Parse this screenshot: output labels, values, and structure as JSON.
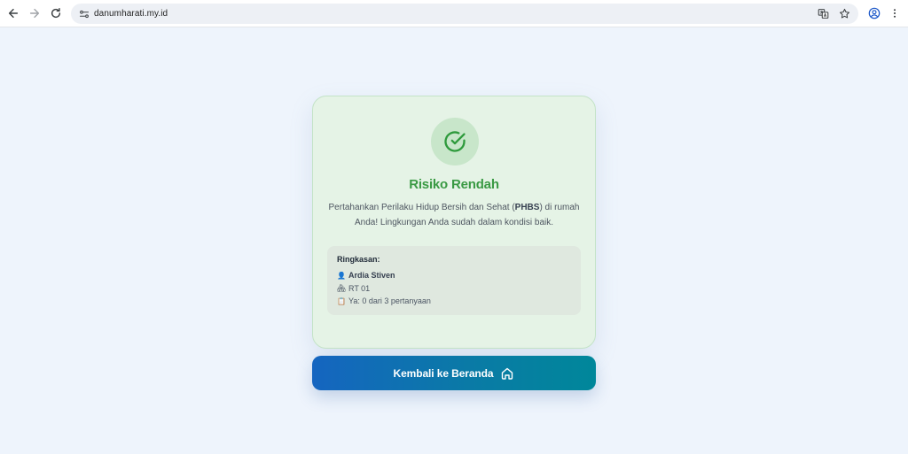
{
  "browser": {
    "url": "danumharati.my.id"
  },
  "result": {
    "status_icon": "check-circle-icon",
    "title": "Risiko Rendah",
    "message_before": "Pertahankan Perilaku Hidup Bersih dan Sehat (",
    "message_bold": "PHBS",
    "message_after": ") di rumah Anda! Lingkungan Anda sudah dalam kondisi baik.",
    "accent_color": "#3a9a44",
    "background_color": "#e5f3e6"
  },
  "summary": {
    "title": "Ringkasan:",
    "name_icon": "👤",
    "name": "Ardia Stiven",
    "rt_icon": "🏘",
    "rt": "RT 01",
    "answers_icon": "📋",
    "answers": "Ya: 0 dari 3 pertanyaan"
  },
  "actions": {
    "home_label": "Kembali ke Beranda",
    "home_icon": "home-icon",
    "gradient_start": "#1565c0",
    "gradient_end": "#00879a"
  }
}
